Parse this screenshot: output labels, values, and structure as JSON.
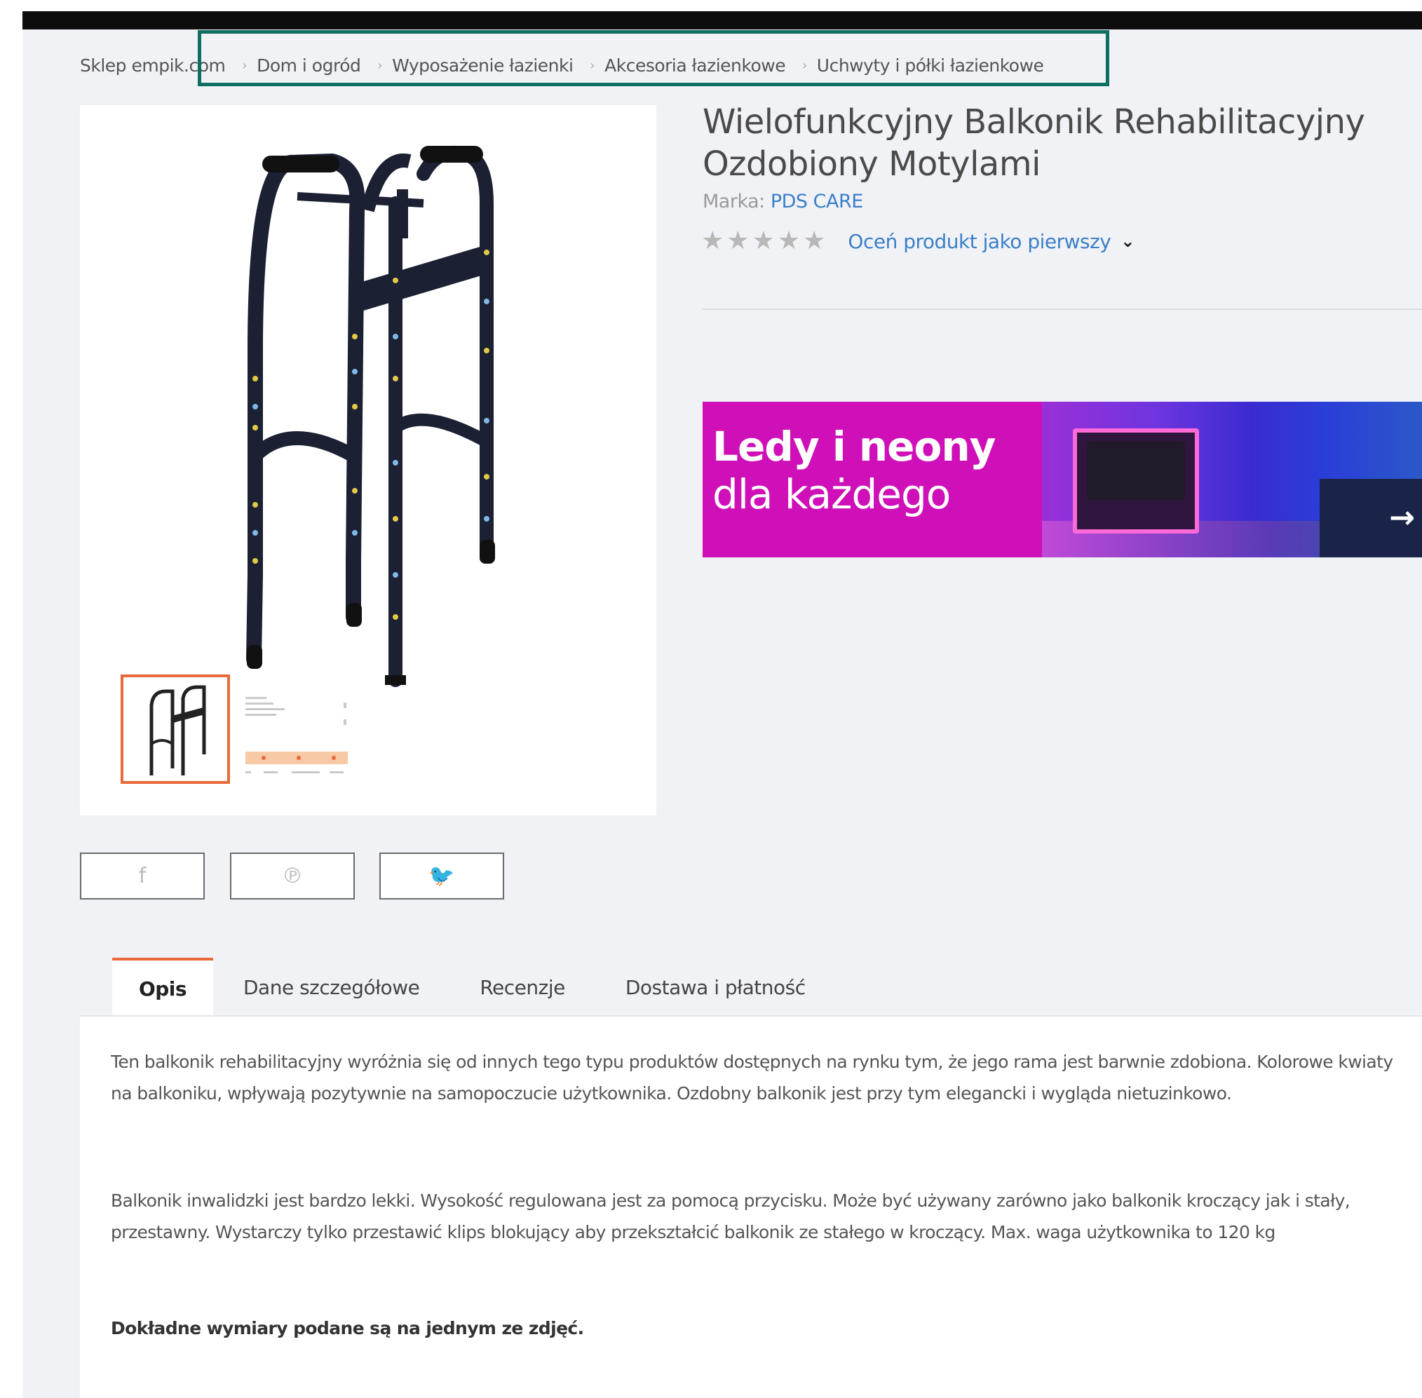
{
  "breadcrumb": {
    "items": [
      "Sklep empik.com",
      "Dom i ogród",
      "Wyposażenie łazienki",
      "Akcesoria łazienkowe",
      "Uchwyty i półki łazienkowe"
    ]
  },
  "product": {
    "title": "Wielofunkcyjny Balkonik Rehabilitacyjny Ozdobiony Motylami",
    "brand_label": "Marka:",
    "brand_name": "PDS CARE",
    "rating_link": "Oceń produkt jako pierwszy",
    "stars": 5
  },
  "banner": {
    "line1": "Ledy i neony",
    "line2": "dla każdego",
    "arrow": "→"
  },
  "share": {
    "facebook": "f",
    "pinterest": "℗",
    "twitter": "🐦"
  },
  "tabs": [
    "Opis",
    "Dane szczegółowe",
    "Recenzje",
    "Dostawa i płatność"
  ],
  "description": {
    "p1": "Ten balkonik rehabilitacyjny wyróżnia się od innych tego typu produktów dostępnych na rynku tym, że jego rama jest barwnie zdobiona. Kolorowe kwiaty na balkoniku, wpływają pozytywnie na samopoczucie użytkownika. Ozdobny balkonik jest przy tym elegancki i wygląda nietuzinkowo.",
    "p2": "Balkonik inwalidzki jest bardzo lekki. Wysokość regulowana jest za pomocą przycisku. Może być używany zarówno jako balkonik kroczący jak i stały, przestawny. Wystarczy tylko przestawić klips blokujący aby przekształcić balkonik ze stałego w kroczący. Max. waga użytkownika to 120 kg",
    "p3": "Dokładne wymiary podane są na jednym ze zdjęć."
  },
  "colors": {
    "accent": "#e8693a",
    "link": "#3b7fc9",
    "highlight": "#0f6e62",
    "banner": "#cf10b8"
  },
  "icons": [
    "facebook-icon",
    "pinterest-icon",
    "twitter-icon",
    "star-icon",
    "chevron-down-icon",
    "arrow-right-icon"
  ]
}
